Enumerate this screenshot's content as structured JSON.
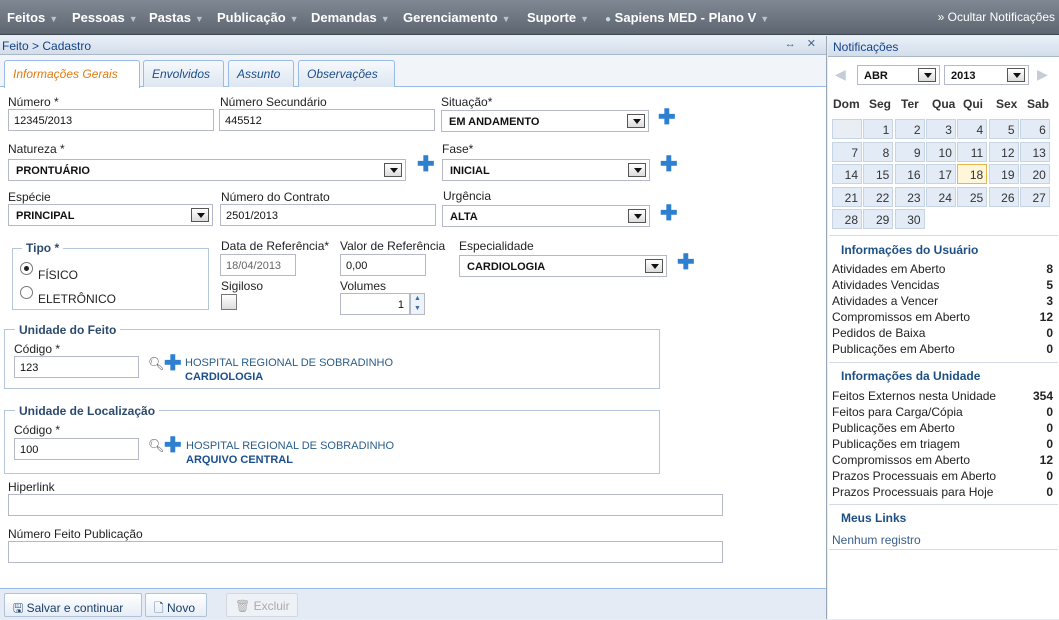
{
  "topmenu": [
    {
      "label": "Feitos"
    },
    {
      "label": "Pessoas"
    },
    {
      "label": "Pastas"
    },
    {
      "label": "Publicação"
    },
    {
      "label": "Demandas"
    },
    {
      "label": "Gerenciamento"
    },
    {
      "label": "Suporte"
    },
    {
      "label": "Sapiens MED - Plano V"
    }
  ],
  "hide_notifications": "» Ocultar Notificações",
  "window": {
    "title": "Feito > Cadastro",
    "tools": "↔ ✕"
  },
  "tabs": [
    {
      "label": "Informações Gerais"
    },
    {
      "label": "Envolvidos"
    },
    {
      "label": "Assunto"
    },
    {
      "label": "Observações"
    }
  ],
  "form": {
    "numero": {
      "label": "Número *",
      "value": "12345/2013"
    },
    "numero_sec": {
      "label": "Número Secundário",
      "value": "445512"
    },
    "situacao": {
      "label": "Situação*",
      "value": "EM ANDAMENTO"
    },
    "natureza": {
      "label": "Natureza *",
      "value": "PRONTUÁRIO"
    },
    "fase": {
      "label": "Fase*",
      "value": "INICIAL"
    },
    "especie": {
      "label": "Espécie",
      "value": "PRINCIPAL"
    },
    "contrato": {
      "label": "Número do Contrato",
      "value": "2501/2013"
    },
    "urgencia": {
      "label": "Urgência",
      "value": "ALTA"
    },
    "tipo": {
      "label": "Tipo *",
      "opt1": "FÍSICO",
      "opt2": "ELETRÔNICO"
    },
    "data_ref": {
      "label": "Data de Referência*",
      "value": "18/04/2013"
    },
    "valor_ref": {
      "label": "Valor de Referência",
      "value": "0,00"
    },
    "especialidade": {
      "label": "Especialidade",
      "value": "CARDIOLOGIA"
    },
    "sigiloso": {
      "label": "Sigiloso"
    },
    "volumes": {
      "label": "Volumes",
      "value": "1"
    },
    "unidade_feito": {
      "title": "Unidade do Feito",
      "codigo_label": "Código *",
      "codigo": "123",
      "hospital": "HOSPITAL REGIONAL DE SOBRADINHO",
      "setor": "CARDIOLOGIA"
    },
    "unidade_loc": {
      "title": "Unidade de Localização",
      "codigo_label": "Código *",
      "codigo": "100",
      "hospital": "HOSPITAL REGIONAL DE SOBRADINHO",
      "setor": "ARQUIVO CENTRAL"
    },
    "hiperlink": {
      "label": "Hiperlink",
      "value": ""
    },
    "num_pub": {
      "label": "Número Feito Publicação",
      "value": ""
    }
  },
  "footer": {
    "save": "Salvar e continuar",
    "new": "Novo",
    "delete": "Excluir"
  },
  "side": {
    "title": "Notificações",
    "month": "ABR",
    "year": "2013",
    "weekdays": [
      "Dom",
      "Seg",
      "Ter",
      "Qua",
      "Qui",
      "Sex",
      "Sab"
    ],
    "days": [
      "",
      "1",
      "2",
      "3",
      "4",
      "5",
      "6",
      "7",
      "8",
      "9",
      "10",
      "11",
      "12",
      "13",
      "14",
      "15",
      "16",
      "17",
      "18",
      "19",
      "20",
      "21",
      "22",
      "23",
      "24",
      "25",
      "26",
      "27",
      "28",
      "29",
      "30"
    ],
    "today": "18",
    "user_title": "Informações do Usuário",
    "user": [
      {
        "label": "Atividades em Aberto",
        "value": "8"
      },
      {
        "label": "Atividades Vencidas",
        "value": "5"
      },
      {
        "label": "Atividades a Vencer",
        "value": "3"
      },
      {
        "label": "Compromissos em Aberto",
        "value": "12"
      },
      {
        "label": "Pedidos de Baixa",
        "value": "0"
      },
      {
        "label": "Publicações em Aberto",
        "value": "0"
      }
    ],
    "unit_title": "Informações da Unidade",
    "unit": [
      {
        "label": "Feitos Externos nesta Unidade",
        "value": "354"
      },
      {
        "label": "Feitos para Carga/Cópia",
        "value": "0"
      },
      {
        "label": "Publicações em Aberto",
        "value": "0"
      },
      {
        "label": "Publicações em triagem",
        "value": "0"
      },
      {
        "label": "Compromissos em Aberto",
        "value": "12"
      },
      {
        "label": "Prazos Processuais em Aberto",
        "value": "0"
      },
      {
        "label": "Prazos Processuais para Hoje",
        "value": "0"
      }
    ],
    "links_title": "Meus Links",
    "links_empty": "Nenhum registro"
  }
}
